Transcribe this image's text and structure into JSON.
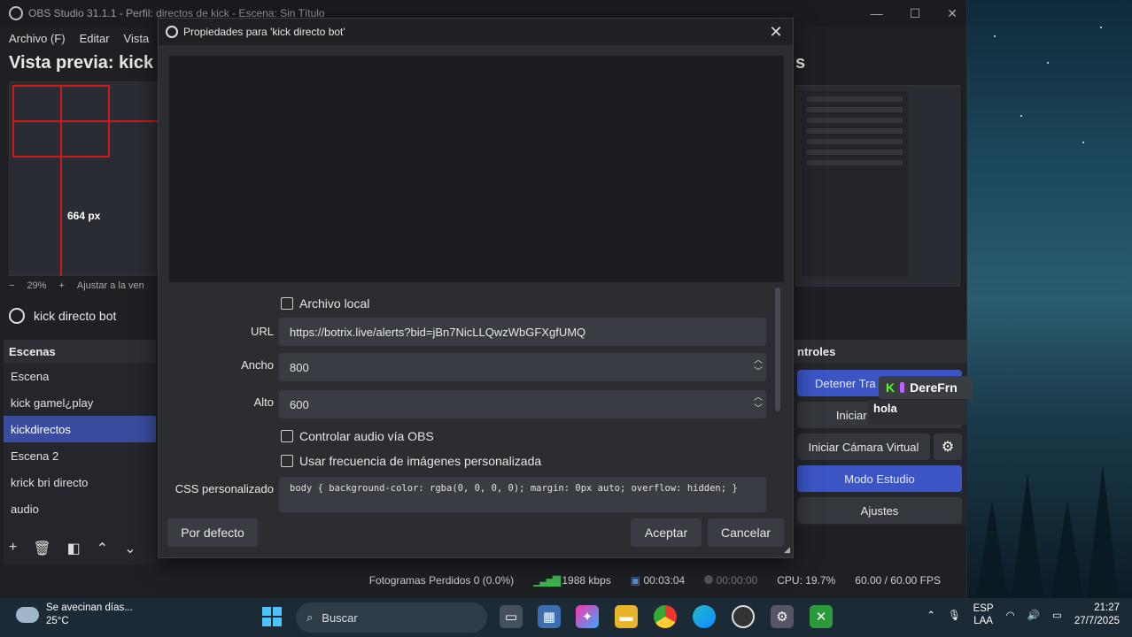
{
  "obs": {
    "title": "OBS Studio 31.1.1 - Perfil: directos de kick - Escena: Sin Título",
    "menu": [
      "Archivo (F)",
      "Editar",
      "Vista"
    ],
    "preview_title": "Vista previa: kick",
    "preview_title_right": "s",
    "preview_px_label": "664 px",
    "zoom": {
      "minus": "−",
      "level": "29%",
      "plus": "+",
      "fit": "Ajustar a la ven"
    },
    "source_name": "kick directo bot",
    "scenes": {
      "header": "Escenas",
      "items": [
        "Escena",
        "kick gamel¿play",
        "kickdirectos",
        "Escena 2",
        "krick bri directo",
        "audio"
      ],
      "active_index": 2
    },
    "controls": {
      "header": "ntroles",
      "stop_stream": "Detener Tra",
      "start_recording": "Iniciar Grabación",
      "virtual_cam": "Iniciar Cámara Virtual",
      "studio_mode": "Modo Estudio",
      "settings": "Ajustes"
    },
    "kick_chat": {
      "user": "DereFrn",
      "message": "hola"
    },
    "status": {
      "dropped_frames": "Fotogramas Perdidos 0 (0.0%)",
      "bitrate": "1988 kbps",
      "stream_time": "00:03:04",
      "rec_time": "00:00:00",
      "cpu": "CPU: 19.7%",
      "fps": "60.00 / 60.00 FPS"
    }
  },
  "dialog": {
    "title": "Propiedades para 'kick directo bot'",
    "local_file_label": "Archivo local",
    "url_label": "URL",
    "url_value": "https://botrix.live/alerts?bid=jBn7NicLLQwzWbGFXgfUMQ",
    "width_label": "Ancho",
    "width_value": "800",
    "height_label": "Alto",
    "height_value": "600",
    "control_audio_label": "Controlar audio vía OBS",
    "custom_fps_label": "Usar frecuencia de imágenes personalizada",
    "css_label": "CSS personalizado",
    "css_value": "body { background-color: rgba(0, 0, 0, 0); margin: 0px auto; overflow: hidden; }",
    "defaults_button": "Por defecto",
    "accept_button": "Aceptar",
    "cancel_button": "Cancelar"
  },
  "taskbar": {
    "weather_line1": "Se avecinan días...",
    "weather_line2": "25°C",
    "search_placeholder": "Buscar",
    "lang_line1": "ESP",
    "lang_line2": "LAA",
    "time": "21:27",
    "date": "27/7/2025"
  }
}
